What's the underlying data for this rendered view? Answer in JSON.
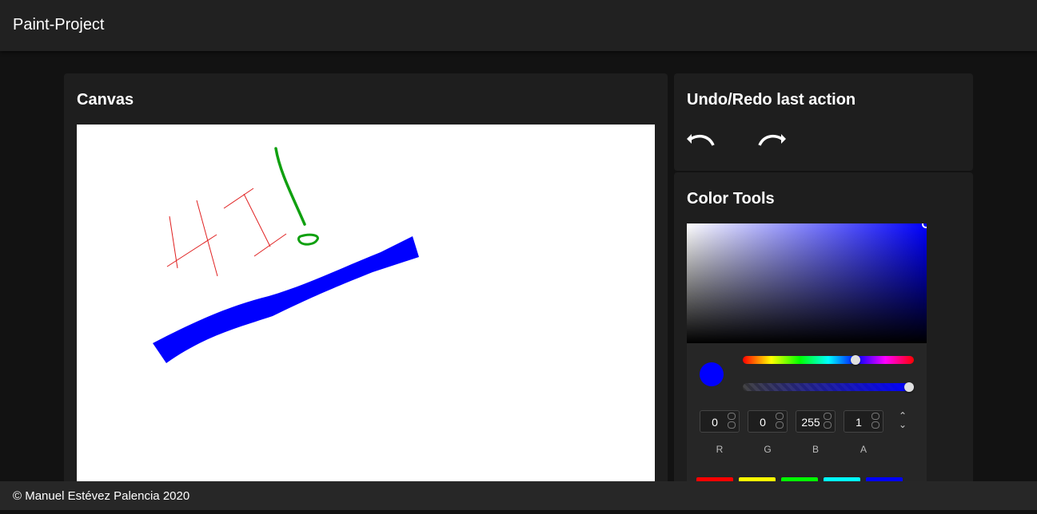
{
  "appbar": {
    "title": "Paint-Project"
  },
  "canvas_card": {
    "title": "Canvas"
  },
  "undo_card": {
    "title": "Undo/Redo last action",
    "undo_icon": "undo-icon",
    "redo_icon": "redo-icon"
  },
  "color_card": {
    "title": "Color Tools",
    "current_color": "#0000ff",
    "hue_level": 0.67,
    "alpha_level": 1.0,
    "channels": [
      {
        "label": "R",
        "value": "0"
      },
      {
        "label": "G",
        "value": "0"
      },
      {
        "label": "B",
        "value": "255"
      },
      {
        "label": "A",
        "value": "1"
      }
    ],
    "presets": [
      "#ff0000",
      "#ffff00",
      "#00ff00",
      "#00ffff",
      "#0000ff"
    ]
  },
  "footer": {
    "text": "© Manuel Estévez Palencia 2020"
  }
}
